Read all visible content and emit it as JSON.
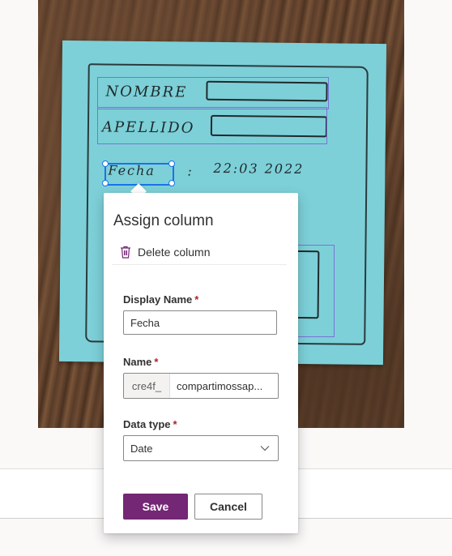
{
  "photo": {
    "handwriting": {
      "field1": "NOMBRE",
      "field2": "APELLIDO",
      "field3_label": "Fecha",
      "field3_colon": ":",
      "field3_value": "22:03 2022"
    }
  },
  "panel": {
    "title": "Assign column",
    "delete_label": "Delete column",
    "display_name": {
      "label": "Display Name",
      "required_mark": "*",
      "value": "Fecha"
    },
    "name": {
      "label": "Name",
      "required_mark": "*",
      "prefix": "cre4f_",
      "value": "compartimossap..."
    },
    "data_type": {
      "label": "Data type",
      "required_mark": "*",
      "selected": "Date"
    },
    "save_label": "Save",
    "cancel_label": "Cancel"
  },
  "colors": {
    "primary_button": "#742774",
    "selection": "#1a73e8",
    "detection_box": "#7a72d6",
    "required": "#a4262c"
  },
  "icons": {
    "delete": "trash-icon",
    "dropdown": "chevron-down-icon"
  }
}
